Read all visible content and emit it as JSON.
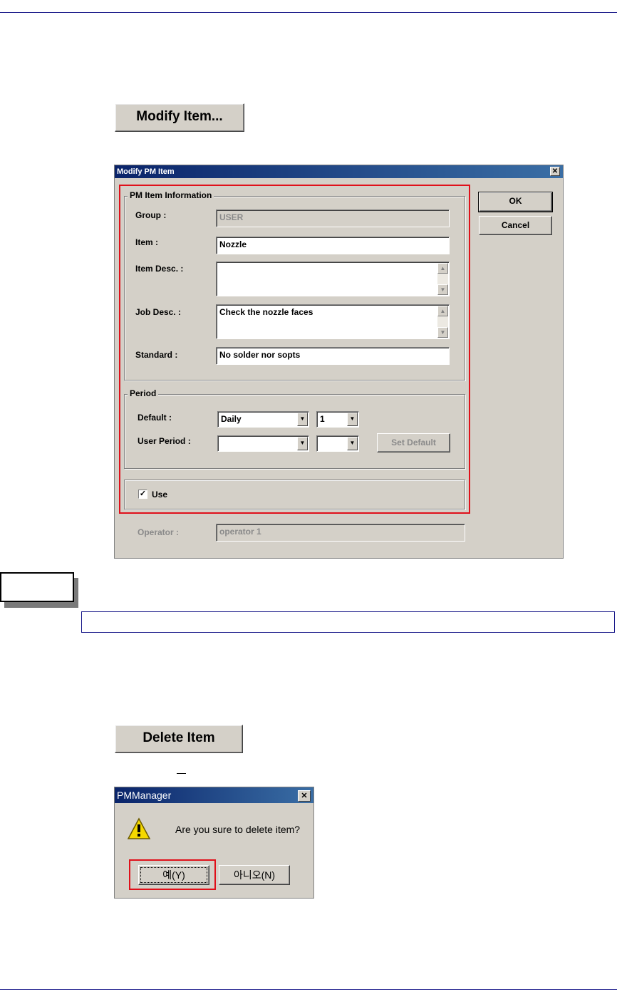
{
  "modify_button": {
    "label": "Modify Item..."
  },
  "modify_dialog": {
    "title": "Modify PM Item",
    "close_glyph": "✕",
    "info_group": "PM Item Information",
    "group_label": "Group :",
    "group_value": "USER",
    "item_label": "Item :",
    "item_value": "Nozzle",
    "item_desc_label": "Item Desc. :",
    "item_desc_value": "",
    "job_desc_label": "Job Desc. :",
    "job_desc_value": "Check the nozzle faces",
    "standard_label": "Standard :",
    "standard_value": "No solder nor sopts",
    "period_group": "Period",
    "default_label": "Default :",
    "default_period": "Daily",
    "default_count": "1",
    "user_period_label": "User Period :",
    "user_period": "",
    "user_count": "",
    "set_default_label": "Set Default",
    "use_label": "Use",
    "use_checked": "✓",
    "operator_label": "Operator :",
    "operator_value": "operator 1",
    "ok_label": "OK",
    "cancel_label": "Cancel"
  },
  "delete_button": {
    "label": "Delete Item"
  },
  "confirm_dialog": {
    "title": "PMManager",
    "close_glyph": "✕",
    "message": "Are you sure to delete item?",
    "yes_label": "예(Y)",
    "no_label": "아니오(N)"
  },
  "colors": {
    "highlight": "#e0101a",
    "rule": "#1a1a8a",
    "dialog_bg": "#d4d0c8"
  }
}
